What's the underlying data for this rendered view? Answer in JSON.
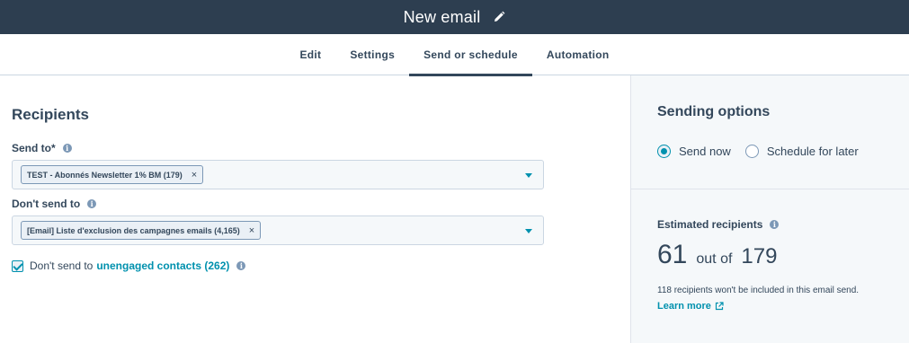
{
  "topbar": {
    "title": "New email",
    "edit_icon": "pencil-icon"
  },
  "tabs": [
    {
      "label": "Edit",
      "active": false
    },
    {
      "label": "Settings",
      "active": false
    },
    {
      "label": "Send or schedule",
      "active": true
    },
    {
      "label": "Automation",
      "active": false
    }
  ],
  "recipients": {
    "heading": "Recipients",
    "send_to": {
      "label": "Send to*",
      "tag": "TEST - Abonnés Newsletter 1% BM (179)",
      "remove": "×"
    },
    "dont_send_to": {
      "label": "Don't send to",
      "tag": "[Email] Liste d'exclusion des campagnes emails (4,165)",
      "remove": "×"
    },
    "unengaged": {
      "checked": true,
      "prefix": "Don't send to",
      "link": "unengaged contacts (262)"
    }
  },
  "sending_options": {
    "heading": "Sending options",
    "options": [
      {
        "label": "Send now",
        "selected": true
      },
      {
        "label": "Schedule for later",
        "selected": false
      }
    ]
  },
  "estimate": {
    "heading": "Estimated recipients",
    "count": "61",
    "out_of": "out of",
    "total": "179",
    "note": "118 recipients won't be included in this email send.",
    "learn_more": "Learn more"
  },
  "colors": {
    "accent": "#0091ae",
    "text": "#33475b",
    "topbar": "#2d3e50"
  }
}
